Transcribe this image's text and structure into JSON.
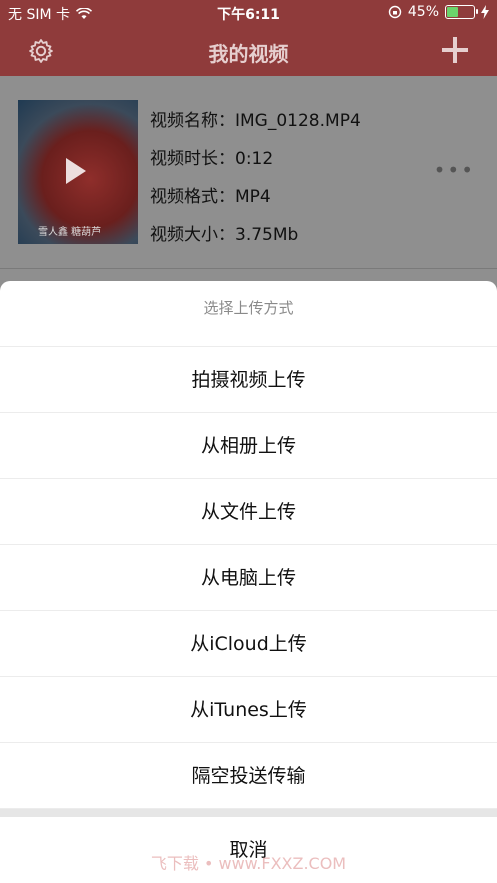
{
  "status_bar": {
    "carrier": "无 SIM 卡",
    "time": "下午6:11",
    "battery_percent": "45%",
    "battery_level": 0.45,
    "icons": [
      "wifi-icon",
      "orientation-lock-icon",
      "battery-icon",
      "charging-icon"
    ]
  },
  "nav": {
    "title": "我的视频",
    "left_icon": "gear-icon",
    "right_icon": "plus-icon",
    "color": "#c0504d"
  },
  "video": {
    "thumbnail_caption": "雪人鑫 糖葫芦",
    "name_label": "视频名称：",
    "name_value": "IMG_0128.MP4",
    "duration_label": "视频时长：",
    "duration_value": "0:12",
    "format_label": "视频格式：",
    "format_value": "MP4",
    "size_label": "视频大小：",
    "size_value": "3.75Mb",
    "more_label": "•••"
  },
  "action_sheet": {
    "title": "选择上传方式",
    "options": [
      "拍摄视频上传",
      "从相册上传",
      "从文件上传",
      "从电脑上传",
      "从iCloud上传",
      "从iTunes上传",
      "隔空投送传输"
    ],
    "cancel": "取消"
  },
  "watermark": "飞下载 • www.FXXZ.COM"
}
